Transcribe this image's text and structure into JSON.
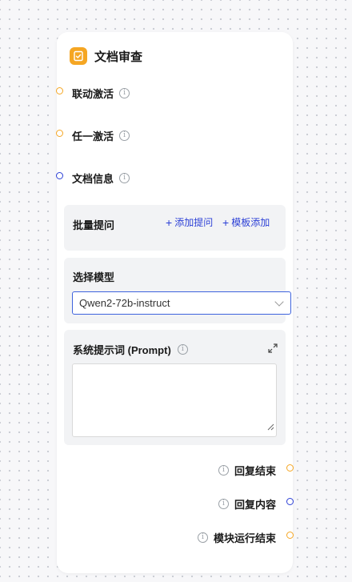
{
  "node": {
    "title": "文档审查",
    "icon": "document-check-icon"
  },
  "inputs": [
    {
      "label": "联动激活",
      "port_color": "#f5a623"
    },
    {
      "label": "任一激活",
      "port_color": "#f5a623"
    },
    {
      "label": "文档信息",
      "port_color": "#2b3fd6"
    }
  ],
  "batch": {
    "title": "批量提问",
    "add_question": "添加提问",
    "template_add": "模板添加"
  },
  "model": {
    "title": "选择模型",
    "selected": "Qwen2-72b-instruct"
  },
  "prompt": {
    "title": "系统提示词 (Prompt)",
    "value": ""
  },
  "outputs": [
    {
      "label": "回复结束",
      "port_color": "#f5a623"
    },
    {
      "label": "回复内容",
      "port_color": "#2b3fd6"
    },
    {
      "label": "模块运行结束",
      "port_color": "#f5a623"
    }
  ],
  "colors": {
    "accent": "#2b3fd6",
    "brand": "#f5a623"
  }
}
